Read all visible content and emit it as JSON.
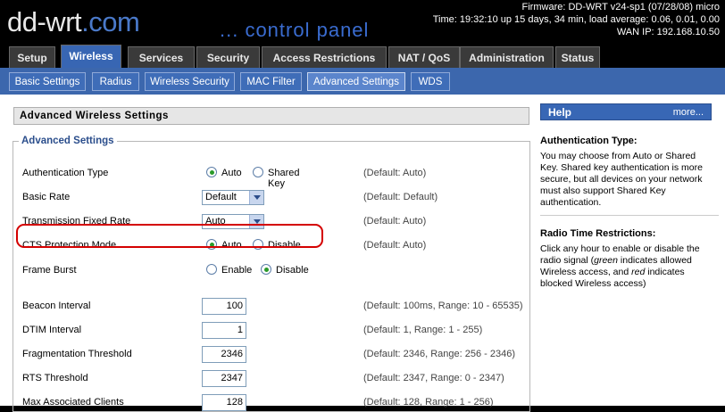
{
  "header": {
    "logo_text": "dd-wrt",
    "logo_dot": ".com",
    "panel_title": "... control panel",
    "firmware": "Firmware: DD-WRT v24-sp1 (07/28/08) micro",
    "time": "Time: 19:32:10 up 15 days, 34 min, load average: 0.06, 0.01, 0.00",
    "wan_ip": "WAN IP: 192.168.10.50"
  },
  "main_tabs": [
    "Setup",
    "Wireless",
    "Services",
    "Security",
    "Access Restrictions",
    "NAT / QoS",
    "Administration",
    "Status"
  ],
  "sub_tabs": [
    "Basic Settings",
    "Radius",
    "Wireless Security",
    "MAC Filter",
    "Advanced Settings",
    "WDS"
  ],
  "page": {
    "heading": "Advanced Wireless Settings",
    "legend": "Advanced Settings"
  },
  "settings": {
    "auth_type": {
      "label": "Authentication Type",
      "opt1": "Auto",
      "opt2": "Shared Key",
      "default": "(Default: Auto)"
    },
    "basic_rate": {
      "label": "Basic Rate",
      "value": "Default",
      "default": "(Default: Default)"
    },
    "tx_rate": {
      "label": "Transmission Fixed Rate",
      "value": "Auto",
      "default": "(Default: Auto)"
    },
    "cts": {
      "label": "CTS Protection Mode",
      "opt1": "Auto",
      "opt2": "Disable",
      "default": "(Default: Auto)"
    },
    "frame_burst": {
      "label": "Frame Burst",
      "opt1": "Enable",
      "opt2": "Disable"
    },
    "beacon": {
      "label": "Beacon Interval",
      "value": "100",
      "default": "(Default: 100ms, Range: 10 - 65535)"
    },
    "dtim": {
      "label": "DTIM Interval",
      "value": "1",
      "default": "(Default: 1, Range: 1 - 255)"
    },
    "frag": {
      "label": "Fragmentation Threshold",
      "value": "2346",
      "default": "(Default: 2346, Range: 256 - 2346)"
    },
    "rts": {
      "label": "RTS Threshold",
      "value": "2347",
      "default": "(Default: 2347, Range: 0 - 2347)"
    },
    "max_clients": {
      "label": "Max Associated Clients",
      "value": "128",
      "default": "(Default: 128, Range: 1 - 256)"
    }
  },
  "help": {
    "title": "Help",
    "more": "more...",
    "sections": [
      {
        "title": "Authentication Type:",
        "body": "You may choose from Auto or Shared Key. Shared key authentication is more secure, but all devices on your network must also support Shared Key authentication."
      },
      {
        "title": "Radio Time Restrictions:",
        "body_parts": [
          "Click any hour to enable or disable the radio signal (",
          "green",
          " indicates allowed Wireless access, and ",
          "red",
          " indicates blocked Wireless access)"
        ]
      }
    ]
  },
  "colors": {
    "tab_active": "#3866b3",
    "subtab_bar": "#3c67ad",
    "help_header": "#3867b5",
    "radio_checked": "#2a9a2a",
    "highlight": "#d40000"
  }
}
